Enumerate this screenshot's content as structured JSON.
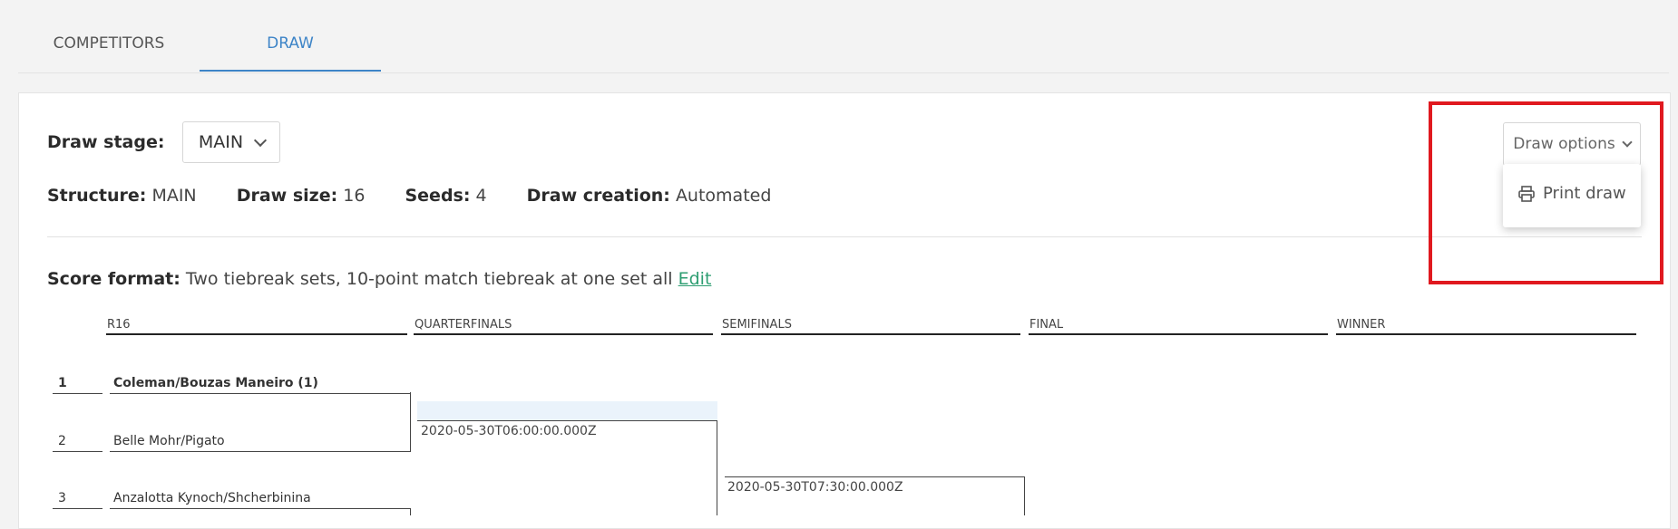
{
  "tabs": [
    {
      "label": "COMPETITORS"
    },
    {
      "label": "DRAW"
    }
  ],
  "draw_stage": {
    "label": "Draw stage:",
    "value": "MAIN"
  },
  "info": {
    "structure_label": "Structure:",
    "structure_value": "MAIN",
    "draw_size_label": "Draw size:",
    "draw_size_value": "16",
    "seeds_label": "Seeds:",
    "seeds_value": "4",
    "draw_creation_label": "Draw creation:",
    "draw_creation_value": "Automated"
  },
  "score_format": {
    "label": "Score format:",
    "value": "Two tiebreak sets, 10-point match tiebreak at one set all",
    "edit_label": "Edit"
  },
  "draw_options": {
    "button_label": "Draw options",
    "menu": [
      {
        "label": "Print draw",
        "icon": "printer-icon"
      }
    ]
  },
  "rounds": [
    "R16",
    "QUARTERFINALS",
    "SEMIFINALS",
    "FINAL",
    "WINNER"
  ],
  "entries": [
    {
      "seed": "1",
      "name": "Coleman/Bouzas Maneiro (1)"
    },
    {
      "seed": "2",
      "name": "Belle Mohr/Pigato"
    },
    {
      "seed": "3",
      "name": "Anzalotta Kynoch/Shcherbinina"
    }
  ],
  "match_times": [
    {
      "time": "2020-05-30T06:00:00.000Z"
    },
    {
      "time": "2020-05-30T07:30:00.000Z"
    }
  ],
  "colors": {
    "accent": "#3d84c7",
    "link": "#2e9e72",
    "highlight": "#e0191f"
  }
}
